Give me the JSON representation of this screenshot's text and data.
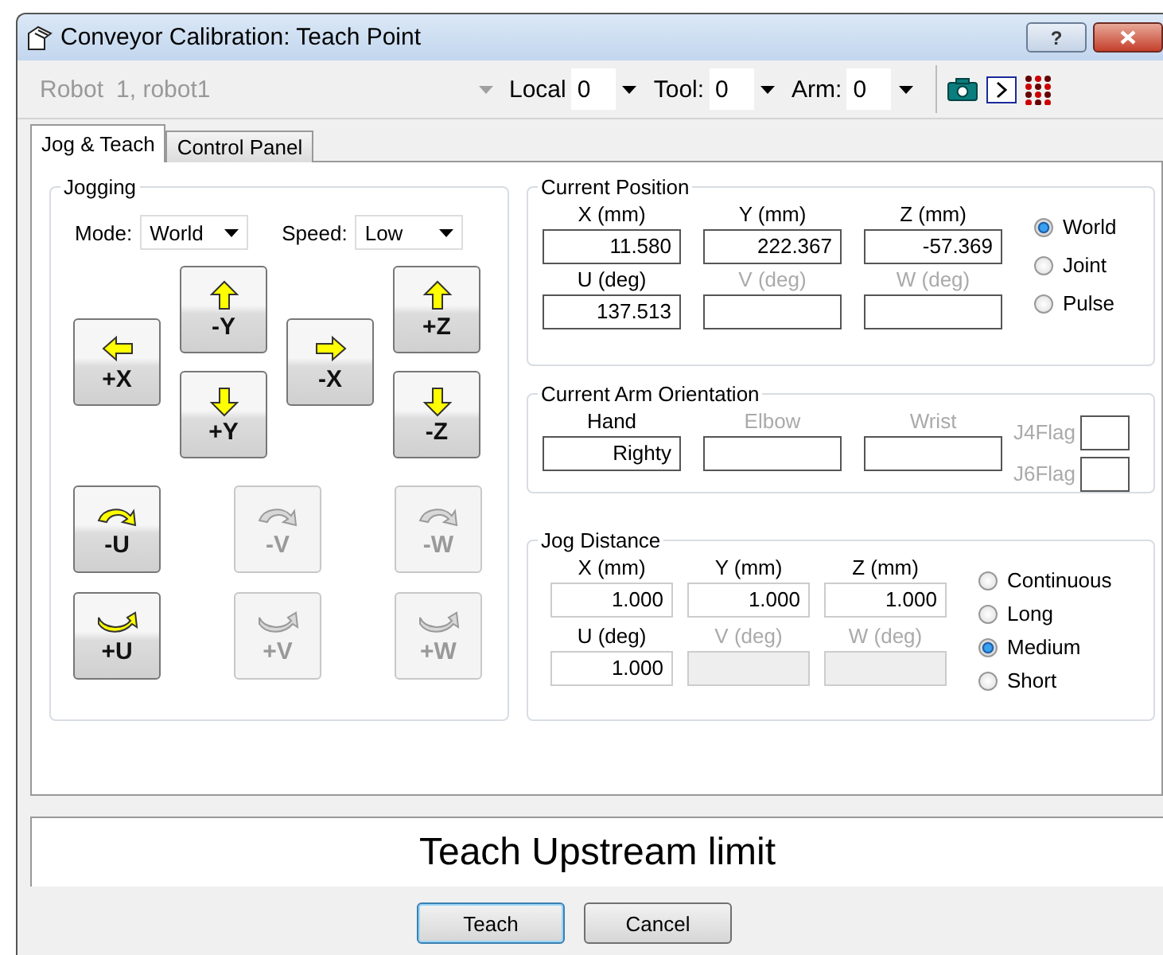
{
  "window": {
    "title": "Conveyor Calibration: Teach Point",
    "help": "?"
  },
  "toolbar": {
    "robot": {
      "label": "Robot",
      "value": "1, robot1",
      "disabled": true
    },
    "combos": [
      {
        "label": "Local",
        "value": "0"
      },
      {
        "label": "Tool:",
        "value": "0"
      },
      {
        "label": "Arm:",
        "value": "0"
      }
    ]
  },
  "tabs": [
    {
      "label": "Jog & Teach",
      "selected": true
    },
    {
      "label": "Control Panel",
      "selected": false
    }
  ],
  "jogging": {
    "title": "Jogging",
    "mode": {
      "label": "Mode:",
      "value": "World"
    },
    "speed": {
      "label": "Speed:",
      "value": "Low"
    },
    "move_buttons": [
      {
        "label": "-Y",
        "kind": "up"
      },
      {
        "label": "+Z",
        "kind": "up"
      },
      {
        "label": "+X",
        "kind": "left"
      },
      {
        "label": "-X",
        "kind": "right"
      },
      {
        "label": "+Y",
        "kind": "down"
      },
      {
        "label": "-Z",
        "kind": "down"
      }
    ],
    "rotate_buttons": [
      {
        "label": "-U",
        "kind": "ccw",
        "disabled": false
      },
      {
        "label": "-V",
        "kind": "ccw",
        "disabled": true
      },
      {
        "label": "-W",
        "kind": "ccw",
        "disabled": true
      },
      {
        "label": "+U",
        "kind": "cw",
        "disabled": false
      },
      {
        "label": "+V",
        "kind": "cw",
        "disabled": true
      },
      {
        "label": "+W",
        "kind": "cw",
        "disabled": true
      }
    ]
  },
  "current_position": {
    "title": "Current Position",
    "fields": [
      {
        "label": "X (mm)",
        "value": "11.580",
        "disabled": false
      },
      {
        "label": "Y (mm)",
        "value": "222.367",
        "disabled": false
      },
      {
        "label": "Z (mm)",
        "value": "-57.369",
        "disabled": false
      },
      {
        "label": "U (deg)",
        "value": "137.513",
        "disabled": false
      },
      {
        "label": "V (deg)",
        "disabled": true
      },
      {
        "label": "W (deg)",
        "disabled": true
      }
    ],
    "modes": [
      {
        "label": "World",
        "selected": true
      },
      {
        "label": "Joint",
        "selected": false
      },
      {
        "label": "Pulse",
        "selected": false
      }
    ]
  },
  "arm_orientation": {
    "title": "Current Arm Orientation",
    "fields": [
      {
        "label": "Hand",
        "value": "Righty",
        "disabled": false
      },
      {
        "label": "Elbow",
        "disabled": true
      },
      {
        "label": "Wrist",
        "disabled": true
      }
    ],
    "flags": [
      {
        "label": "J4Flag",
        "disabled": true
      },
      {
        "label": "J6Flag",
        "disabled": true
      }
    ]
  },
  "jog_distance": {
    "title": "Jog Distance",
    "fields": [
      {
        "label": "X (mm)",
        "value": "1.000",
        "disabled": false
      },
      {
        "label": "Y (mm)",
        "value": "1.000",
        "disabled": false
      },
      {
        "label": "Z (mm)",
        "value": "1.000",
        "disabled": false
      },
      {
        "label": "U (deg)",
        "value": "1.000",
        "disabled": false
      },
      {
        "label": "V (deg)",
        "disabled": true
      },
      {
        "label": "W (deg)",
        "disabled": true
      }
    ],
    "modes": [
      {
        "label": "Continuous",
        "selected": false
      },
      {
        "label": "Long",
        "selected": false
      },
      {
        "label": "Medium",
        "selected": true
      },
      {
        "label": "Short",
        "selected": false
      }
    ]
  },
  "message": "Teach Upstream limit",
  "buttons": [
    {
      "label": "Teach",
      "default": true
    },
    {
      "label": "Cancel",
      "default": false
    }
  ]
}
